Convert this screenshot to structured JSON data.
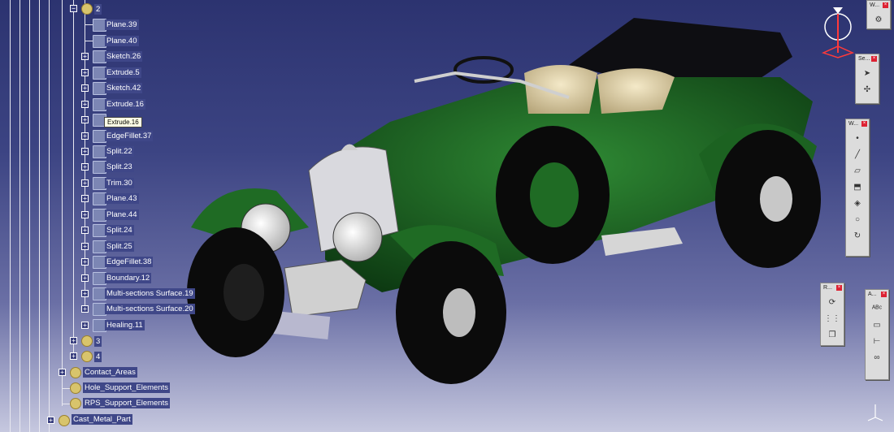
{
  "tree": {
    "root_label": "2",
    "items": [
      {
        "label": "Plane.39"
      },
      {
        "label": "Plane.40"
      },
      {
        "label": "Sketch.26"
      },
      {
        "label": "Extrude.5"
      },
      {
        "label": "Sketch.42"
      },
      {
        "label": "Extrude.16"
      },
      {
        "label": ""
      },
      {
        "label": "EdgeFillet.37"
      },
      {
        "label": "Split.22"
      },
      {
        "label": "Split.23"
      },
      {
        "label": "Trim.30"
      },
      {
        "label": "Plane.43"
      },
      {
        "label": "Plane.44"
      },
      {
        "label": "Split.24"
      },
      {
        "label": "Split.25"
      },
      {
        "label": "EdgeFillet.38"
      },
      {
        "label": "Boundary.12"
      },
      {
        "label": "Multi-sections Surface.19"
      },
      {
        "label": "Multi-sections Surface.20"
      },
      {
        "label": "Healing.11"
      }
    ],
    "node_3": "3",
    "node_4": "4",
    "contact_areas": "Contact_Areas",
    "hole_support": "Hole_Support_Elements",
    "rps_support": "RPS_Support_Elements",
    "cast_metal": "Cast_Metal_Part"
  },
  "tooltip": "Extrude.16",
  "toolbars": {
    "w_top": "W...",
    "se": "Se...",
    "w_mid": "W...",
    "r": "R...",
    "a": "A..."
  },
  "colors": {
    "background_top": "#2c3370",
    "car_body": "#1f6b24",
    "tree_label_bg": "#3f4788"
  }
}
